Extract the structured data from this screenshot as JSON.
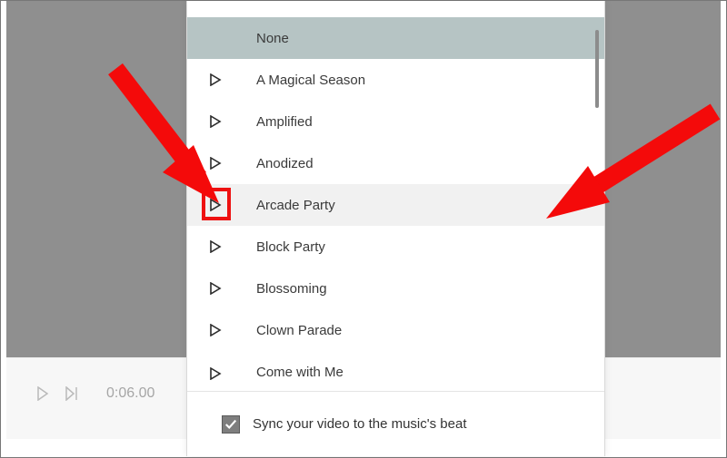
{
  "playback": {
    "timecode": "0:06.00"
  },
  "musicList": {
    "selectedIndex": 0,
    "hoverIndex": 4,
    "highlightPlayIndex": 4,
    "items": [
      {
        "label": "None",
        "hasPlay": false
      },
      {
        "label": "A Magical Season",
        "hasPlay": true
      },
      {
        "label": "Amplified",
        "hasPlay": true
      },
      {
        "label": "Anodized",
        "hasPlay": true
      },
      {
        "label": "Arcade Party",
        "hasPlay": true
      },
      {
        "label": "Block Party",
        "hasPlay": true
      },
      {
        "label": "Blossoming",
        "hasPlay": true
      },
      {
        "label": "Clown Parade",
        "hasPlay": true
      },
      {
        "label": "Come with Me",
        "hasPlay": true
      }
    ]
  },
  "footer": {
    "syncChecked": true,
    "syncLabel": "Sync your video to the music's beat"
  },
  "annotations": {
    "arrowColor": "#f40a0a"
  }
}
